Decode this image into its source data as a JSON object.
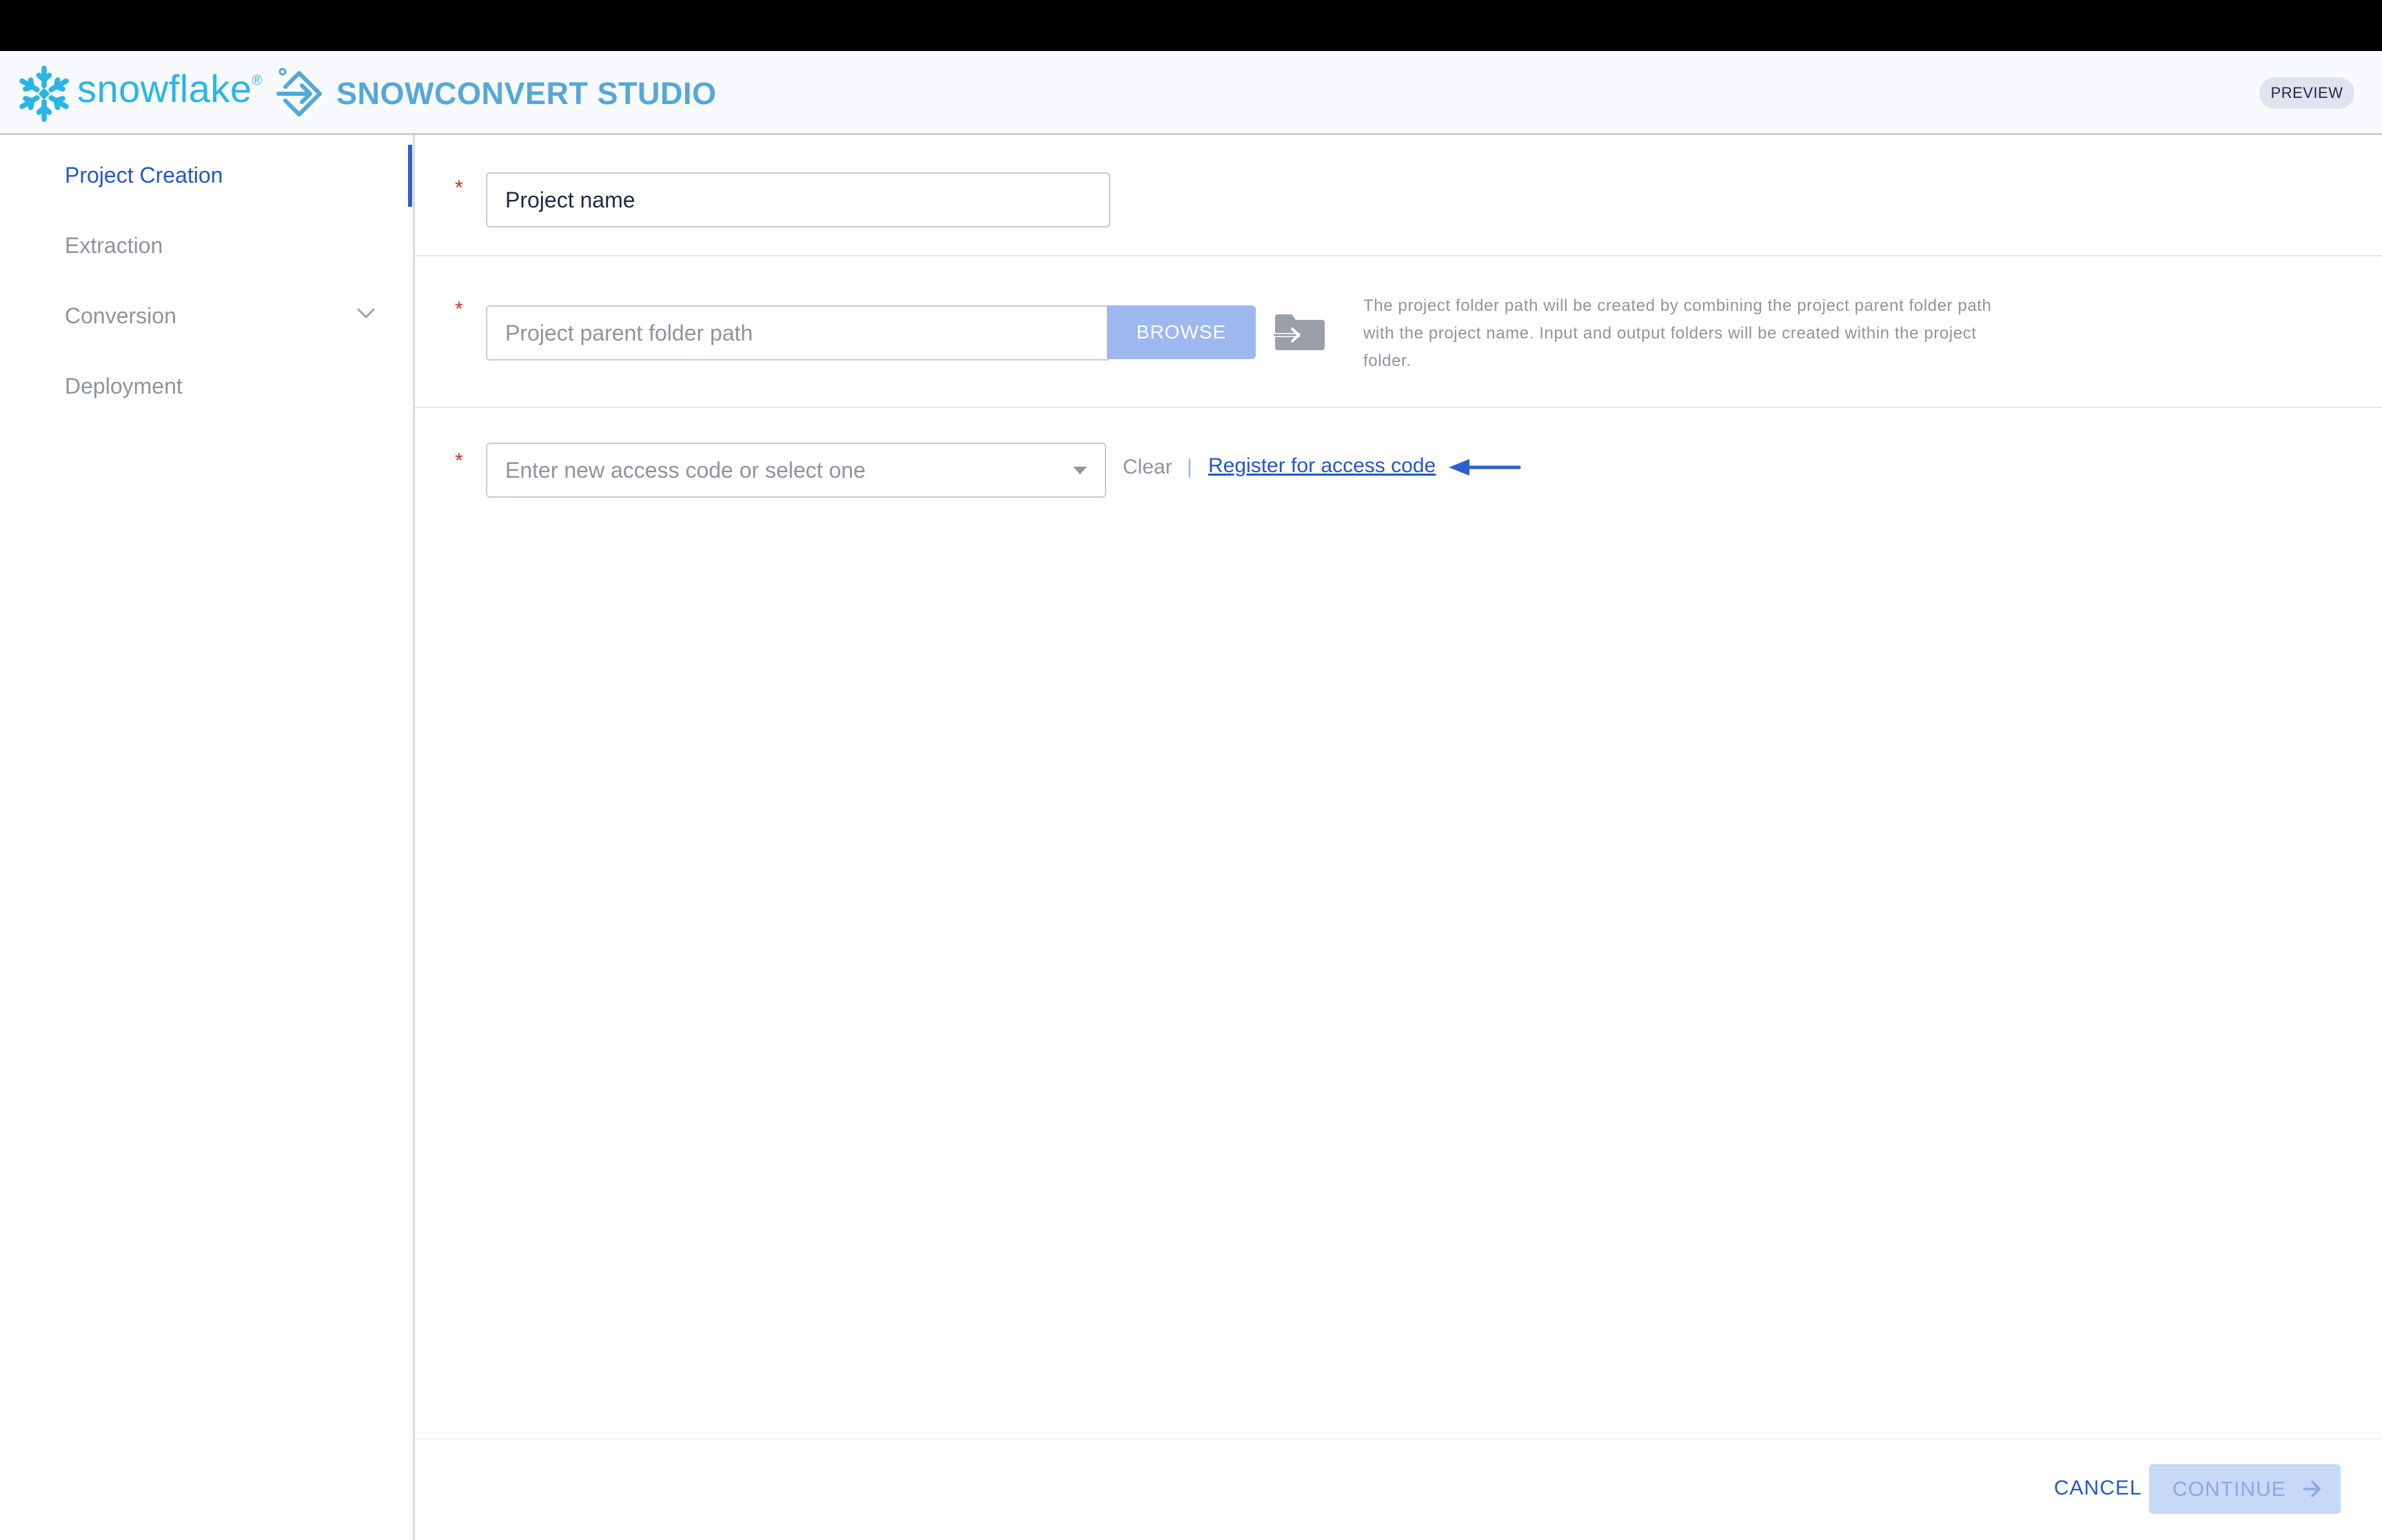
{
  "header": {
    "brand": "snowflake",
    "brand_mark": "®",
    "product": "SNOWCONVERT STUDIO",
    "badge": "PREVIEW",
    "icons": {
      "logo": "snowflake-logo-icon",
      "product": "snowconvert-icon"
    }
  },
  "sidebar": {
    "items": [
      {
        "label": "Project Creation",
        "active": true
      },
      {
        "label": "Extraction",
        "active": false
      },
      {
        "label": "Conversion",
        "active": false,
        "icon": "chevron-down-icon"
      },
      {
        "label": "Deployment",
        "active": false
      }
    ]
  },
  "form": {
    "required_marker": "*",
    "project_name": {
      "placeholder": "Project name",
      "value": ""
    },
    "parent_folder": {
      "placeholder": "Project parent folder path",
      "value": "",
      "browse_label": "BROWSE",
      "icon": "folder-import-icon",
      "hint": "The project folder path will be created by combining the project parent folder path with the project name. Input and output folders will be created within the project folder."
    },
    "access_code": {
      "placeholder": "Enter new access code or select one",
      "value": "",
      "clear_label": "Clear",
      "separator": "|",
      "register_label": "Register for access code",
      "annotation_icon": "arrow-left-icon"
    }
  },
  "footer": {
    "cancel_label": "CANCEL",
    "continue_label": "CONTINUE",
    "continue_icon": "arrow-right-icon"
  },
  "colors": {
    "accent": "#2257c9",
    "brand": "#29b5e8",
    "required": "#d22d2d",
    "browse_bg": "#9db7ef",
    "continue_disabled_bg": "#c8d8f7"
  }
}
